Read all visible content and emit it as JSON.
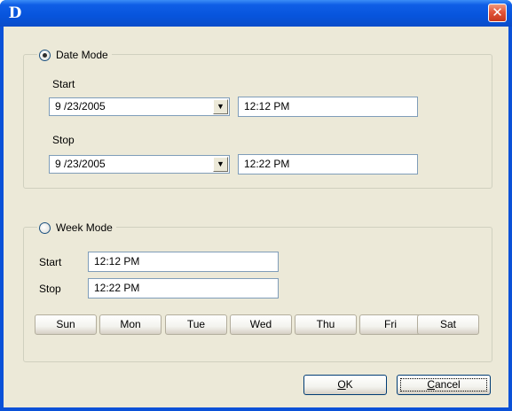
{
  "window": {
    "app_icon_letter": "D",
    "close_glyph": "✕"
  },
  "date_mode": {
    "radio_label": "Date Mode",
    "selected": true,
    "start_label": "Start",
    "start_date": "9 /23/2005",
    "start_time": "12:12 PM",
    "stop_label": "Stop",
    "stop_date": "9 /23/2005",
    "stop_time": "12:22 PM"
  },
  "week_mode": {
    "radio_label": "Week Mode",
    "selected": false,
    "start_label": "Start",
    "start_time": "12:12 PM",
    "stop_label": "Stop",
    "stop_time": "12:22 PM",
    "days": [
      "Sun",
      "Mon",
      "Tue",
      "Wed",
      "Thu",
      "Fri",
      "Sat"
    ]
  },
  "buttons": {
    "ok_mnemonic": "O",
    "ok_rest": "K",
    "cancel_mnemonic": "C",
    "cancel_rest": "ancel"
  },
  "colors": {
    "title_bar": "#0754dc",
    "dialog_face": "#ece9d8",
    "close_button": "#e2553a"
  }
}
